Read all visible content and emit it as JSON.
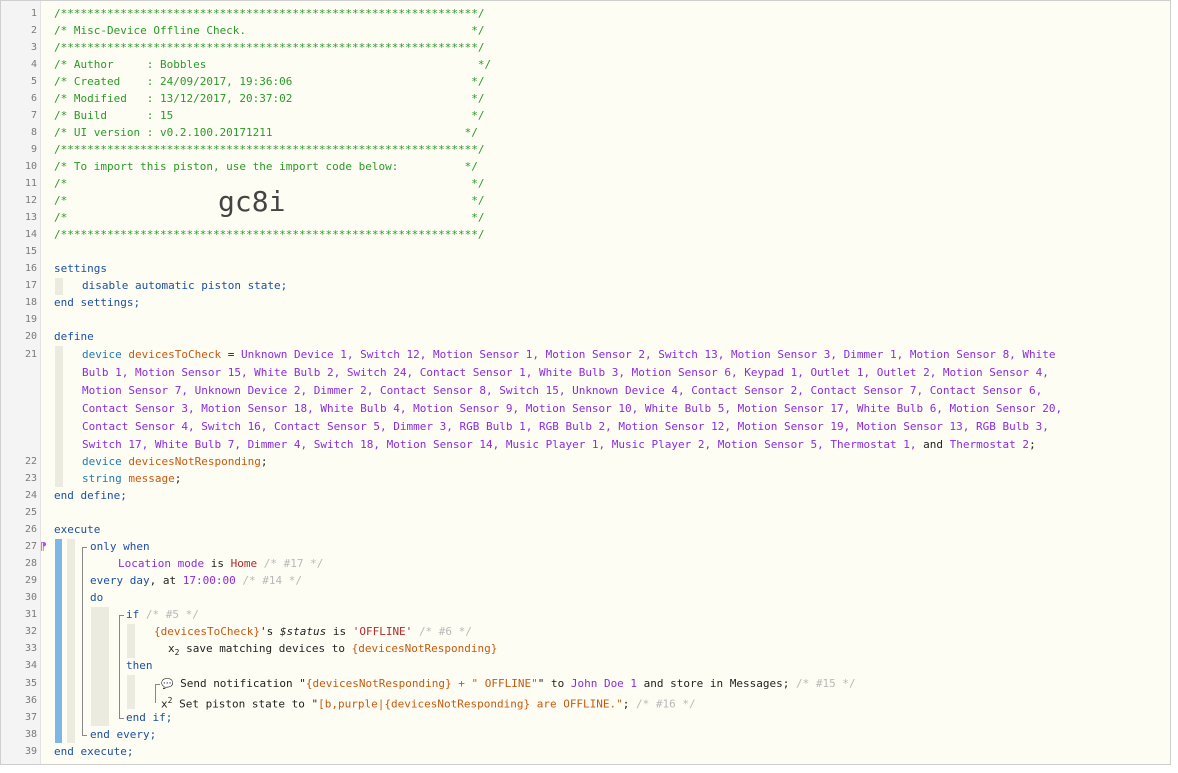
{
  "line_numbers": [
    "1",
    "2",
    "3",
    "4",
    "5",
    "6",
    "7",
    "8",
    "9",
    "10",
    "11",
    "12",
    "13",
    "14",
    "15",
    "16",
    "17",
    "18",
    "19",
    "20",
    "21",
    "22",
    "23",
    "24",
    "25",
    "26",
    "27",
    "28",
    "29",
    "30",
    "31",
    "32",
    "33",
    "34",
    "35",
    "36",
    "37",
    "38",
    "39"
  ],
  "header": {
    "stars": "/***************************************************************/",
    "title": "/* Misc-Device Offline Check.                                  */",
    "author": "/* Author     : Bobbles                                         */",
    "created": "/* Created    : 24/09/2017, 19:36:06                           */",
    "modified": "/* Modified   : 13/12/2017, 20:37:02                           */",
    "build": "/* Build      : 15                                             */",
    "ui_version": "/* UI version : v0.2.100.20171211                             */",
    "import_line": "/* To import this piston, use the import code below:          */",
    "blank_comment": "/*                                                             */",
    "import_code": "gc8i"
  },
  "settings": {
    "open": "settings",
    "body": "disable automatic piston state;",
    "close": "end settings;"
  },
  "define": {
    "open": "define",
    "kw_device": "device",
    "var1": "devicesToCheck",
    "eq": " = ",
    "devices_lines": [
      "Unknown Device 1, Switch 12, Motion Sensor 1, Motion Sensor 2, Switch 13, Motion Sensor 3, Dimmer 1, Motion Sensor 8, White",
      "Bulb 1, Motion Sensor 15, White Bulb 2, Switch 24, Contact Sensor 1, White Bulb 3, Motion Sensor 6, Keypad 1, Outlet 1, Outlet 2, Motion Sensor 4,",
      "Motion Sensor 7, Unknown Device 2, Dimmer 2, Contact Sensor 8, Switch 15, Unknown Device 4, Contact Sensor 2, Contact Sensor 7, Contact Sensor 6,",
      "Contact Sensor 3, Motion Sensor 18, White Bulb 4, Motion Sensor 9, Motion Sensor 10, White Bulb 5, Motion Sensor 17, White Bulb 6, Motion Sensor 20,",
      "Contact Sensor 4, Switch 16, Contact Sensor 5, Dimmer 3, RGB Bulb 1, RGB Bulb 2, Motion Sensor 12, Motion Sensor 19, Motion Sensor 13, RGB Bulb 3,",
      "Switch 17, White Bulb 7, Dimmer 4, Switch 18, Motion Sensor 14, Music Player 1, Music Player 2, Motion Sensor 5, Thermostat 1,"
    ],
    "and_word": " and ",
    "last_device": "Thermostat 2",
    "semicolon": ";",
    "var2": "devicesNotResponding",
    "kw_string": "string",
    "var3": "message",
    "close": "end define;"
  },
  "execute": {
    "open": "execute",
    "only_when": "only when",
    "location": "Location mode",
    "is": " is ",
    "home": "Home",
    "c17": "/* #17 */",
    "every_day": "every day",
    "at": ", at ",
    "time": "17:00:00",
    "c14": "/* #14 */",
    "do": "do",
    "if": "if",
    "c5": "/* #5 */",
    "cond_var": "{devicesToCheck}",
    "cond_mid": "'s ",
    "cond_status": "$status",
    "cond_is": " is ",
    "cond_val": "'OFFLINE'",
    "c6": "/* #6 */",
    "save_prefix": "x",
    "save_sub": "2",
    "save_text": " save matching devices to ",
    "save_var": "{devicesNotResponding}",
    "then": "then",
    "notif_icon": "💬",
    "notif_text": " Send notification \"",
    "notif_var": "{devicesNotResponding} + \" OFFLINE\"",
    "notif_to": "\" to ",
    "notif_user": "John Doe 1",
    "notif_store": " and store in Messages;",
    "c15": "/* #15 */",
    "state_prefix": "x",
    "state_sup": "2",
    "state_text": " Set piston state to \"",
    "state_val": "[b,purple|{devicesNotResponding} are OFFLINE.\"",
    "state_end": ";",
    "c16": "/* #16 */",
    "end_if": "end if;",
    "end_every": "end every;",
    "close": "end execute;",
    "pilcrow": "⁋"
  }
}
